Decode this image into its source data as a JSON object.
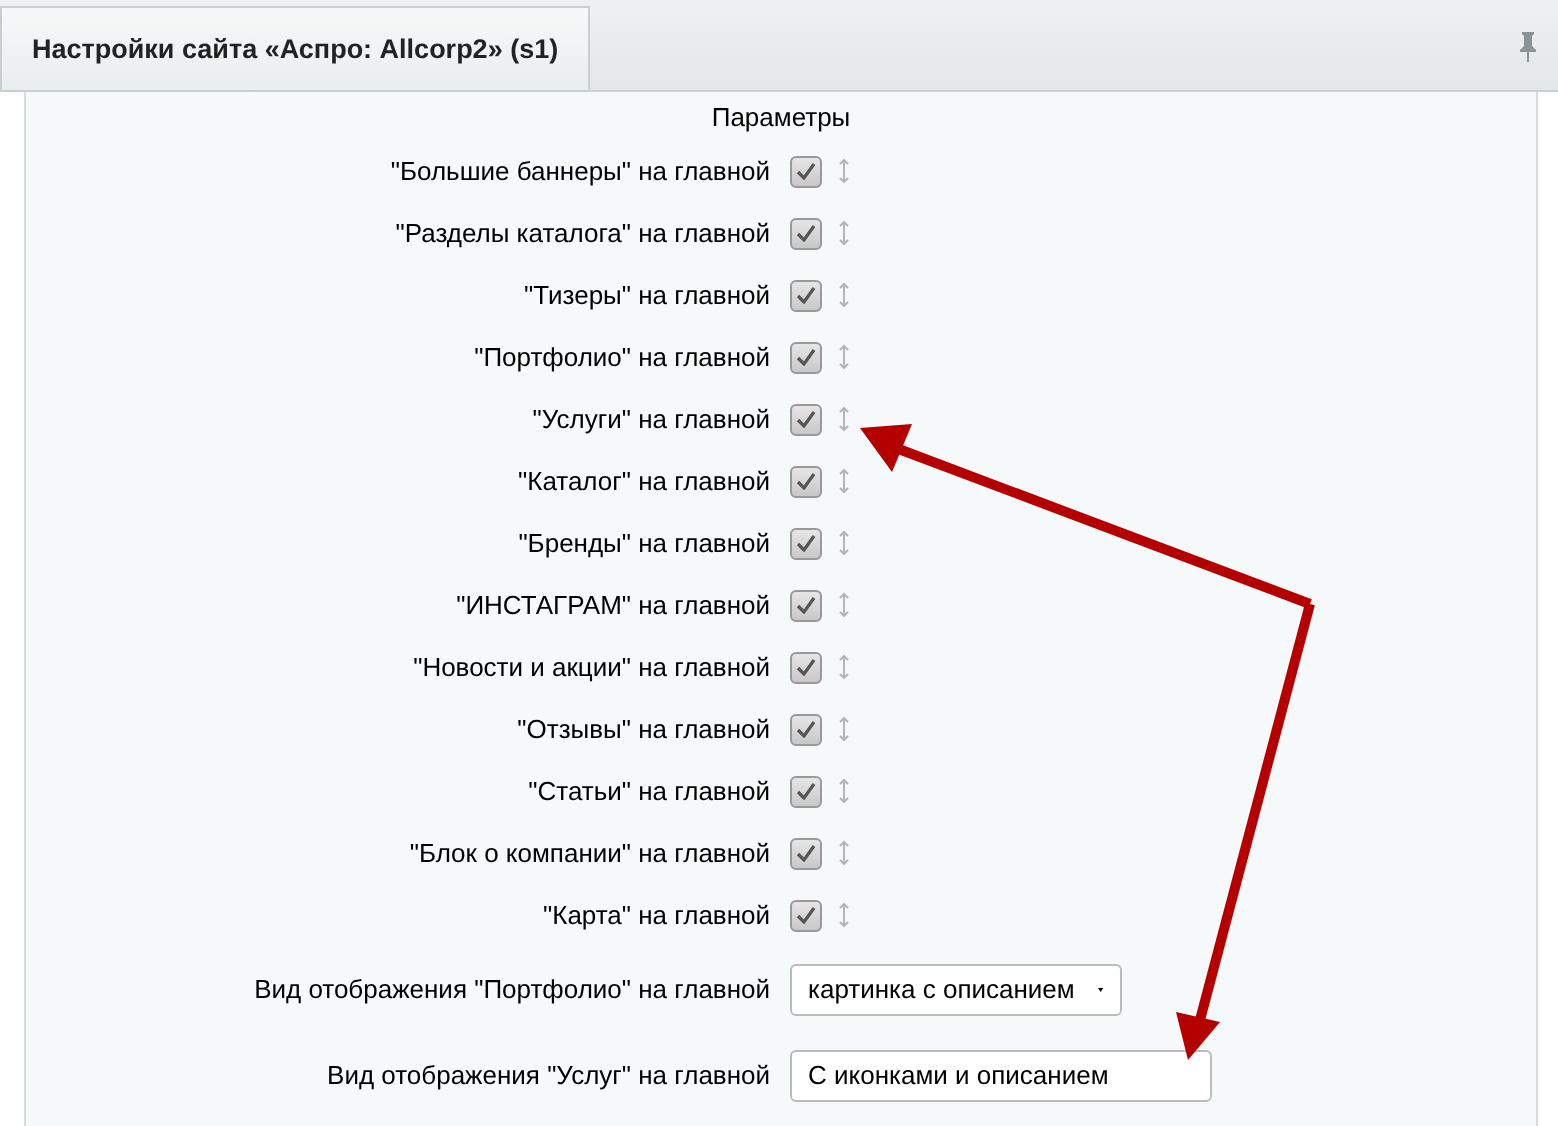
{
  "tab": {
    "title": "Настройки сайта «Аспро: Allcorp2» (s1)",
    "selected": true
  },
  "section": {
    "title": "Параметры"
  },
  "options": [
    {
      "label": "\"Большие баннеры\" на главной",
      "checked": true
    },
    {
      "label": "\"Разделы каталога\" на главной",
      "checked": true
    },
    {
      "label": "\"Тизеры\" на главной",
      "checked": true
    },
    {
      "label": "\"Портфолио\" на главной",
      "checked": true
    },
    {
      "label": "\"Услуги\" на главной",
      "checked": true
    },
    {
      "label": "\"Каталог\" на главной",
      "checked": true
    },
    {
      "label": "\"Бренды\" на главной",
      "checked": true
    },
    {
      "label": "\"ИНСТАГРАМ\" на главной",
      "checked": true
    },
    {
      "label": "\"Новости и акции\" на главной",
      "checked": true
    },
    {
      "label": "\"Отзывы\" на главной",
      "checked": true
    },
    {
      "label": "\"Статьи\" на главной",
      "checked": true
    },
    {
      "label": "\"Блок о компании\" на главной",
      "checked": true
    },
    {
      "label": "\"Карта\" на главной",
      "checked": true
    }
  ],
  "fields": [
    {
      "label": "Вид отображения \"Портфолио\" на главной",
      "kind": "select",
      "value": "картинка с описанием"
    },
    {
      "label": "Вид отображения \"Услуг\" на главной",
      "kind": "text",
      "value": "С иконками и описанием"
    }
  ]
}
